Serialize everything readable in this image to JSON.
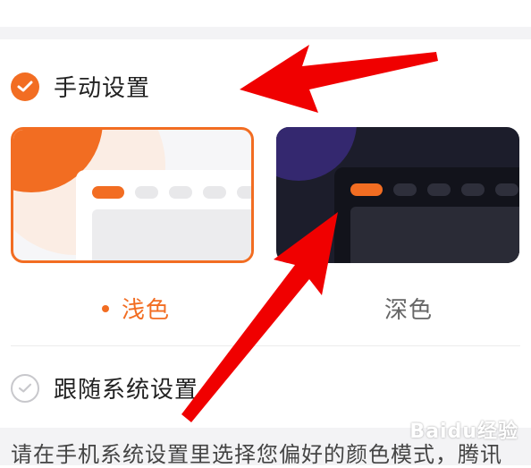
{
  "manual_option": {
    "label": "手动设置",
    "selected": true
  },
  "themes": [
    {
      "label": "浅色",
      "selected": true
    },
    {
      "label": "深色",
      "selected": false
    }
  ],
  "follow_system_option": {
    "label": "跟随系统设置",
    "selected": false
  },
  "description": "请在手机系统设置里选择您偏好的颜色模式，腾讯",
  "watermark": "Baidu经验",
  "colors": {
    "accent": "#f26d22",
    "arrow": "#f00000",
    "dark_card": "#1c1d2b"
  }
}
